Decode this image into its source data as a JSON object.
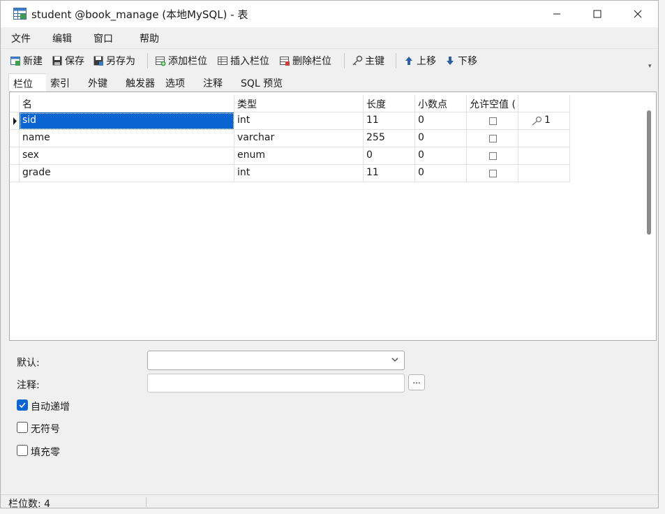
{
  "window": {
    "title": "student @book_manage (本地MySQL) - 表",
    "icon": "table-icon"
  },
  "menu": {
    "items": [
      "文件",
      "编辑",
      "窗口",
      "帮助"
    ]
  },
  "toolbar": {
    "buttons": [
      {
        "label": "新建",
        "icon": "new-table-icon"
      },
      {
        "label": "保存",
        "icon": "save-icon"
      },
      {
        "label": "另存为",
        "icon": "save-as-icon"
      },
      {
        "label": "添加栏位",
        "icon": "add-column-icon"
      },
      {
        "label": "插入栏位",
        "icon": "insert-column-icon"
      },
      {
        "label": "删除栏位",
        "icon": "delete-column-icon"
      },
      {
        "label": "主键",
        "icon": "key-icon"
      },
      {
        "label": "上移",
        "icon": "arrow-up-icon"
      },
      {
        "label": "下移",
        "icon": "arrow-down-icon"
      }
    ]
  },
  "tabs": [
    "栏位",
    "索引",
    "外键",
    "触发器",
    "选项",
    "注释",
    "SQL 预览"
  ],
  "grid": {
    "headers": [
      "名",
      "类型",
      "长度",
      "小数点",
      "允许空值 ("
    ],
    "rows": [
      {
        "name": "sid",
        "type": "int",
        "length": "11",
        "decimals": "0",
        "nullable": false,
        "key": "1"
      },
      {
        "name": "name",
        "type": "varchar",
        "length": "255",
        "decimals": "0",
        "nullable": false,
        "key": ""
      },
      {
        "name": "sex",
        "type": "enum",
        "length": "0",
        "decimals": "0",
        "nullable": false,
        "key": ""
      },
      {
        "name": "grade",
        "type": "int",
        "length": "11",
        "decimals": "0",
        "nullable": false,
        "key": ""
      }
    ]
  },
  "properties": {
    "default_label": "默认:",
    "default_value": "",
    "comment_label": "注释:",
    "comment_value": "",
    "ellipsis": "...",
    "auto_increment_label": "自动递增",
    "auto_increment": true,
    "unsigned_label": "无符号",
    "unsigned": false,
    "zerofill_label": "填充零",
    "zerofill": false
  },
  "status": {
    "field_count": "栏位数: 4"
  },
  "colors": {
    "selection": "#0a64d2",
    "accent_blue": "#0a64d2"
  }
}
